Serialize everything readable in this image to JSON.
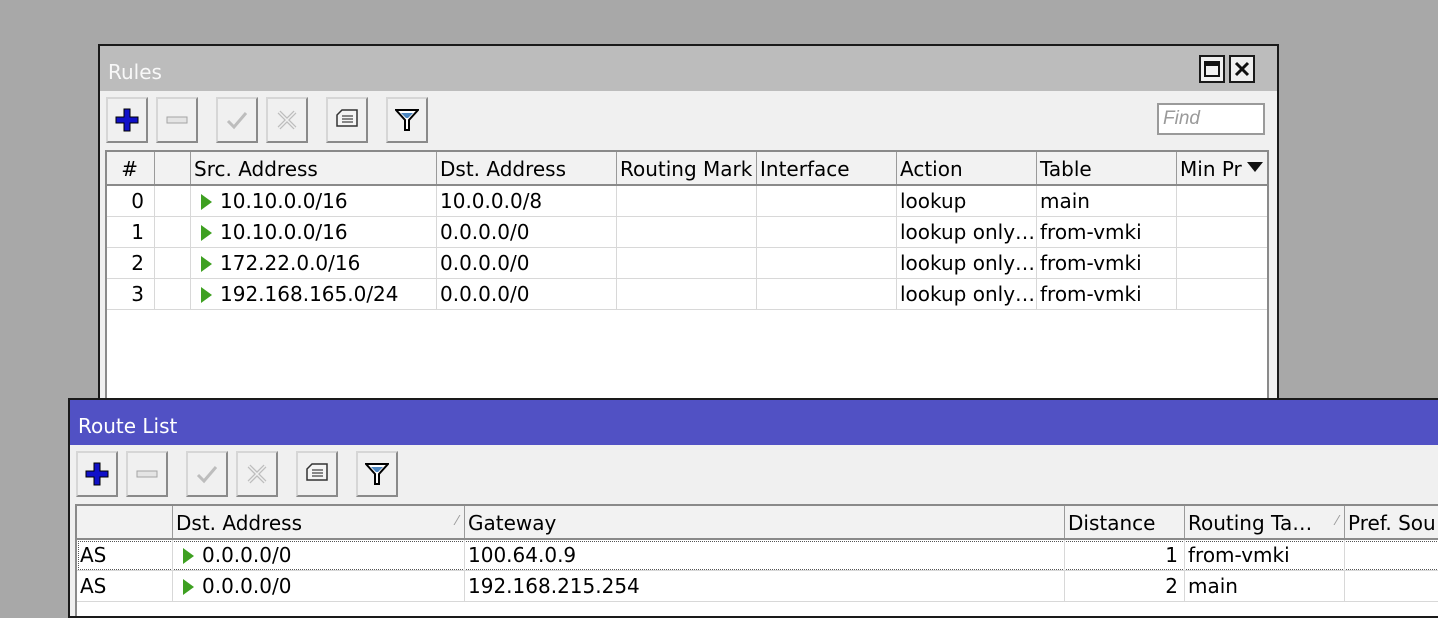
{
  "rules_window": {
    "title": "Rules",
    "find_placeholder": "Find",
    "columns": [
      "#",
      "",
      "Src. Address",
      "Dst. Address",
      "Routing Mark",
      "Interface",
      "Action",
      "Table",
      "Min Pr"
    ],
    "rows": [
      {
        "num": "0",
        "src": "10.10.0.0/16",
        "dst": "10.0.0.0/8",
        "routing_mark": "",
        "interface": "",
        "action": "lookup",
        "table": "main",
        "min_prefix": ""
      },
      {
        "num": "1",
        "src": "10.10.0.0/16",
        "dst": "0.0.0.0/0",
        "routing_mark": "",
        "interface": "",
        "action": "lookup only…",
        "table": "from-vmki",
        "min_prefix": ""
      },
      {
        "num": "2",
        "src": "172.22.0.0/16",
        "dst": "0.0.0.0/0",
        "routing_mark": "",
        "interface": "",
        "action": "lookup only…",
        "table": "from-vmki",
        "min_prefix": ""
      },
      {
        "num": "3",
        "src": "192.168.165.0/24",
        "dst": "0.0.0.0/0",
        "routing_mark": "",
        "interface": "",
        "action": "lookup only…",
        "table": "from-vmki",
        "min_prefix": ""
      }
    ]
  },
  "route_window": {
    "title": "Route List",
    "columns": [
      "",
      "Dst. Address",
      "Gateway",
      "Distance",
      "Routing Ta…",
      "Pref. Sou"
    ],
    "rows": [
      {
        "flags": "AS",
        "dst": "0.0.0.0/0",
        "gateway": "100.64.0.9",
        "distance": "1",
        "routing_table": "from-vmki",
        "pref_source": ""
      },
      {
        "flags": "AS",
        "dst": "0.0.0.0/0",
        "gateway": "192.168.215.254",
        "distance": "2",
        "routing_table": "main",
        "pref_source": ""
      }
    ]
  },
  "colors": {
    "desktop": "#a8a8a8",
    "inactive_title": "#bcbcbc",
    "active_title": "#5151c4",
    "add_icon": "#1010c8",
    "status_triangle": "#3ea021"
  },
  "icons": [
    "add-icon",
    "remove-icon",
    "enable-icon",
    "disable-icon",
    "comment-icon",
    "filter-icon",
    "maximize-icon",
    "close-icon",
    "status-triangle-icon",
    "column-menu-icon"
  ]
}
